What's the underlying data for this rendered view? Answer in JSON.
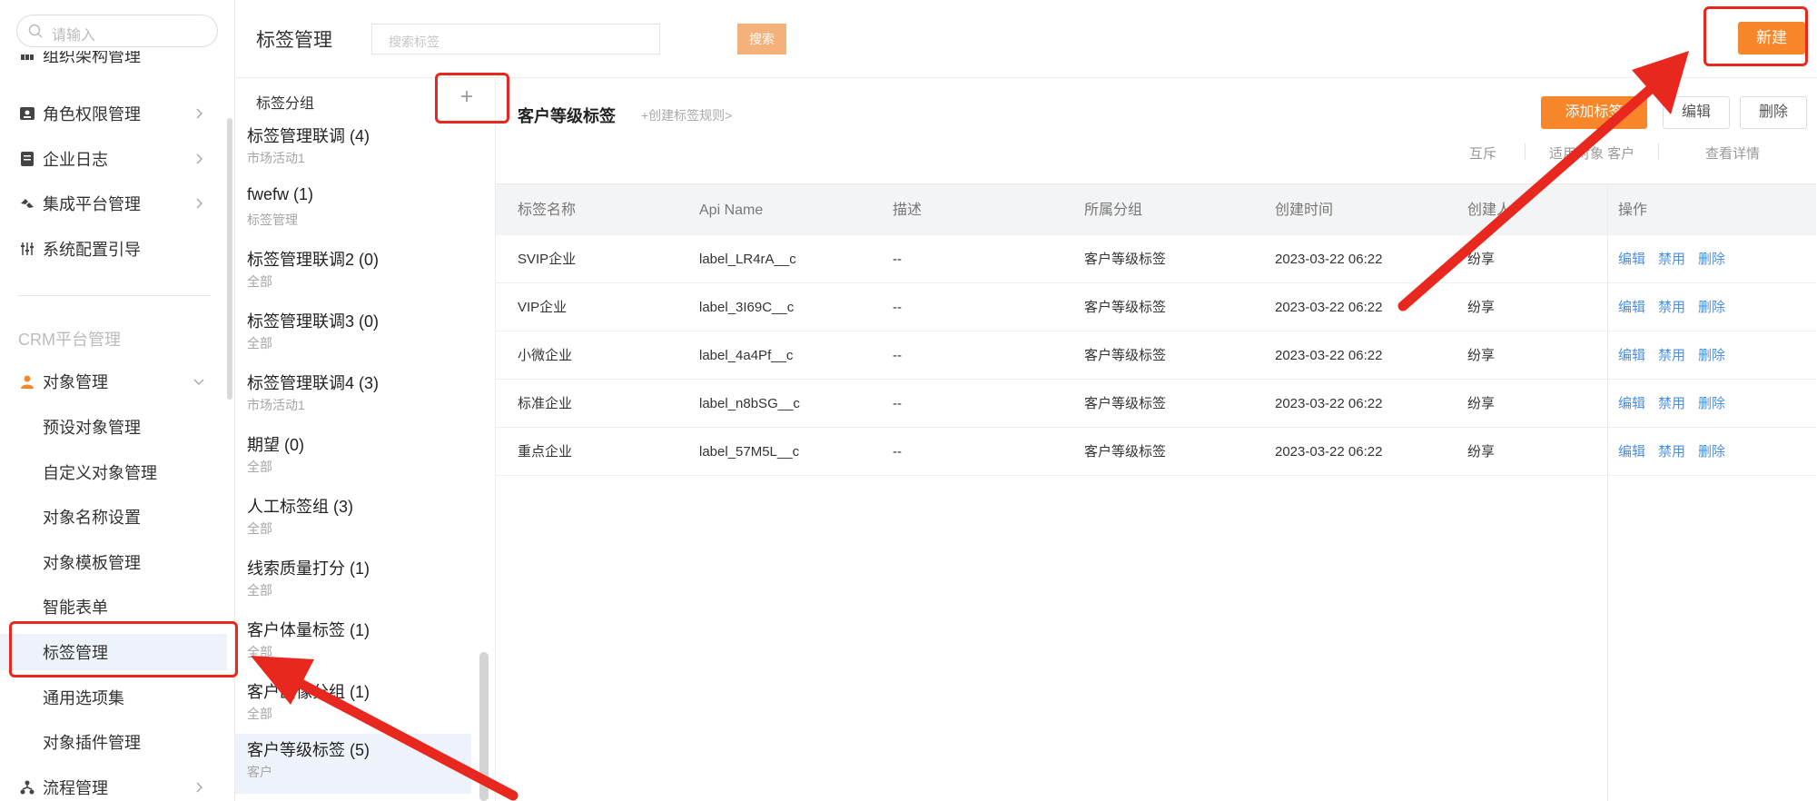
{
  "sidebar": {
    "search_placeholder": "请输入",
    "items": [
      {
        "label": "组织架构管理",
        "icon": "org-icon"
      },
      {
        "label": "角色权限管理",
        "icon": "id-card-icon"
      },
      {
        "label": "企业日志",
        "icon": "log-icon"
      },
      {
        "label": "集成平台管理",
        "icon": "integration-icon"
      },
      {
        "label": "系统配置引导",
        "icon": "config-icon"
      }
    ],
    "section_label": "CRM平台管理",
    "object_mgmt": {
      "label": "对象管理",
      "icon": "person-icon"
    },
    "sub_items": [
      {
        "label": "预设对象管理"
      },
      {
        "label": "自定义对象管理"
      },
      {
        "label": "对象名称设置"
      },
      {
        "label": "对象模板管理"
      },
      {
        "label": "智能表单"
      },
      {
        "label": "标签管理"
      },
      {
        "label": "通用选项集"
      },
      {
        "label": "对象插件管理"
      }
    ],
    "flow_mgmt": {
      "label": "流程管理",
      "icon": "flow-icon"
    }
  },
  "header": {
    "title": "标签管理",
    "search_placeholder": "搜索标签",
    "search_button": "搜索",
    "new_button": "新建"
  },
  "groups": {
    "title": "标签分组",
    "add_symbol": "+",
    "items": [
      {
        "name": "标签管理联调 (4)",
        "sub": "市场活动1"
      },
      {
        "name": "fwefw (1)",
        "sub": "标签管理"
      },
      {
        "name": "标签管理联调2 (0)",
        "sub": "全部"
      },
      {
        "name": "标签管理联调3 (0)",
        "sub": "全部"
      },
      {
        "name": "标签管理联调4 (3)",
        "sub": "市场活动1"
      },
      {
        "name": "期望 (0)",
        "sub": "全部"
      },
      {
        "name": "人工标签组 (3)",
        "sub": "全部"
      },
      {
        "name": "线索质量打分 (1)",
        "sub": "全部"
      },
      {
        "name": "客户体量标签 (1)",
        "sub": "全部"
      },
      {
        "name": "客户画像分组 (1)",
        "sub": "全部"
      },
      {
        "name": "客户等级标签 (5)",
        "sub": "客户"
      }
    ]
  },
  "main": {
    "title": "客户等级标签",
    "create_rule": "+创建标签规则>",
    "add_button": "添加标签",
    "edit_button": "编辑",
    "delete_button": "删除",
    "meta_mutex": "互斥",
    "meta_object": "适用对象 客户",
    "meta_detail": "查看详情",
    "columns": [
      "标签名称",
      "Api Name",
      "描述",
      "所属分组",
      "创建时间",
      "创建人",
      "操作"
    ],
    "rows": [
      {
        "name": "SVIP企业",
        "api": "label_LR4rA__c",
        "desc": "--",
        "group": "客户等级标签",
        "time": "2023-03-22 06:22",
        "creator": "纷享"
      },
      {
        "name": "VIP企业",
        "api": "label_3I69C__c",
        "desc": "--",
        "group": "客户等级标签",
        "time": "2023-03-22 06:22",
        "creator": "纷享"
      },
      {
        "name": "小微企业",
        "api": "label_4a4Pf__c",
        "desc": "--",
        "group": "客户等级标签",
        "time": "2023-03-22 06:22",
        "creator": "纷享"
      },
      {
        "name": "标准企业",
        "api": "label_n8bSG__c",
        "desc": "--",
        "group": "客户等级标签",
        "time": "2023-03-22 06:22",
        "creator": "纷享"
      },
      {
        "name": "重点企业",
        "api": "label_57M5L__c",
        "desc": "--",
        "group": "客户等级标签",
        "time": "2023-03-22 06:22",
        "creator": "纷享"
      }
    ],
    "ops": [
      "编辑",
      "禁用",
      "删除"
    ]
  },
  "colors": {
    "accent": "#f7862a",
    "link": "#4a8fe7",
    "annotation": "#e8281f"
  }
}
